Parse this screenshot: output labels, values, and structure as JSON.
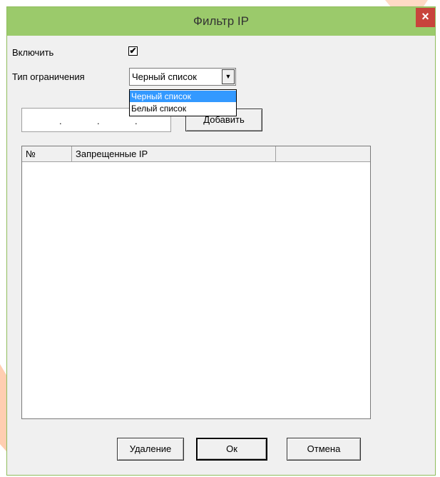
{
  "window": {
    "title": "Фильтр IP",
    "close_label": "×"
  },
  "enable": {
    "label": "Включить",
    "checked_mark": "✔"
  },
  "restriction": {
    "label": "Тип ограничения",
    "selected": "Черный список",
    "arrow": "▼",
    "options": [
      "Черный список",
      "Белый список"
    ]
  },
  "ip": {
    "separators": [
      ".",
      ".",
      "."
    ]
  },
  "add_button": "Добавить",
  "table": {
    "columns": [
      "№",
      "Запрещенные IP",
      ""
    ],
    "rows": []
  },
  "buttons": {
    "delete": "Удаление",
    "ok": "Ок",
    "cancel": "Отмена"
  },
  "colors": {
    "titlebar": "#9bca6b",
    "close": "#c8443c",
    "selection": "#3399ff"
  }
}
